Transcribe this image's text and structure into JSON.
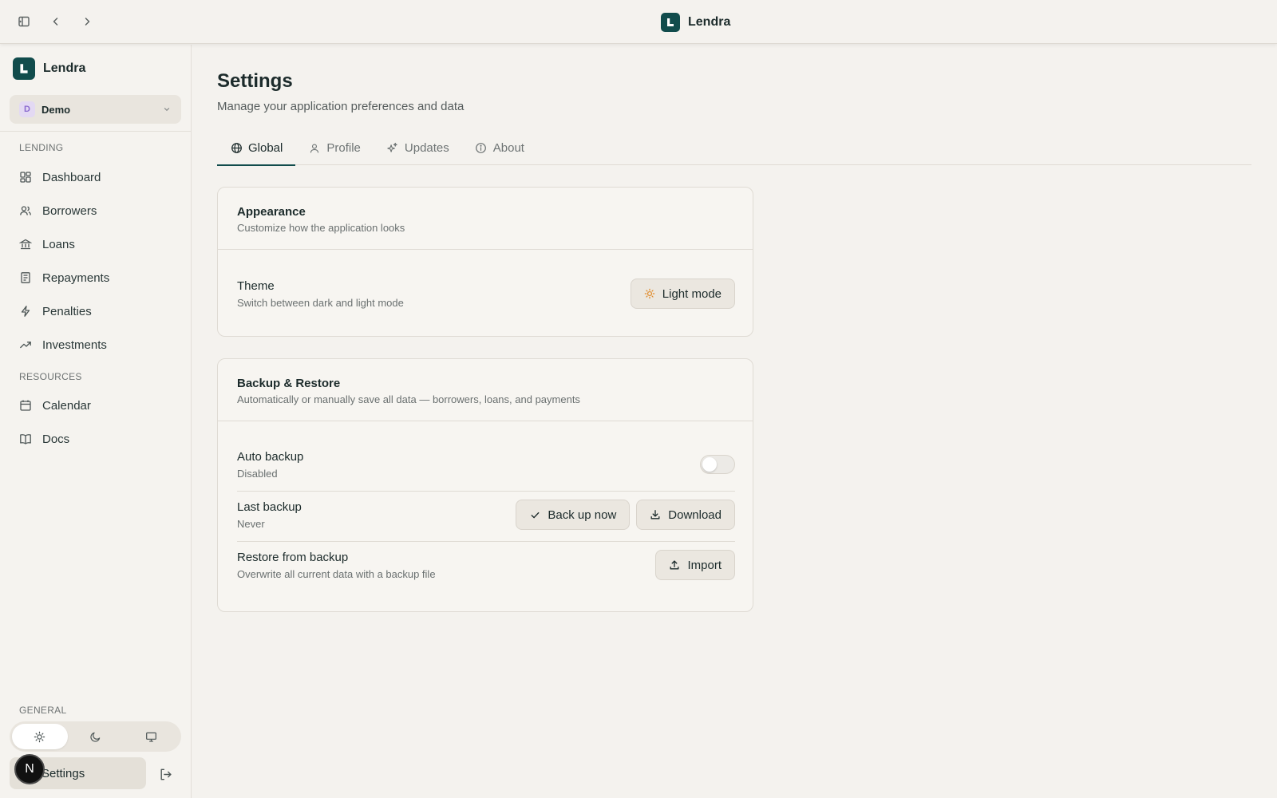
{
  "app": {
    "name": "Lendra"
  },
  "topbar": {
    "sidebar_toggle_icon": "sidebar-toggle-icon",
    "back_icon": "chevron-left-icon",
    "forward_icon": "chevron-right-icon",
    "brand": "Lendra"
  },
  "sidebar": {
    "brand": "Lendra",
    "workspace": {
      "initial": "D",
      "name": "Demo"
    },
    "sections": {
      "lending": "LENDING",
      "resources": "RESOURCES",
      "general": "GENERAL"
    },
    "lending_items": [
      {
        "label": "Dashboard",
        "icon": "dashboard-icon"
      },
      {
        "label": "Borrowers",
        "icon": "users-icon"
      },
      {
        "label": "Loans",
        "icon": "bank-icon"
      },
      {
        "label": "Repayments",
        "icon": "receipt-icon"
      },
      {
        "label": "Penalties",
        "icon": "lightning-icon"
      },
      {
        "label": "Investments",
        "icon": "trending-up-icon"
      }
    ],
    "resource_items": [
      {
        "label": "Calendar",
        "icon": "calendar-icon"
      },
      {
        "label": "Docs",
        "icon": "book-icon"
      }
    ],
    "theme_options": [
      "light",
      "dark",
      "system"
    ],
    "theme_selected": "light",
    "settings_label": "Settings",
    "user_initial": "N"
  },
  "main": {
    "title": "Settings",
    "subtitle": "Manage your application preferences and data",
    "tabs": [
      {
        "label": "Global",
        "icon": "globe-icon",
        "active": true
      },
      {
        "label": "Profile",
        "icon": "user-icon",
        "active": false
      },
      {
        "label": "Updates",
        "icon": "sparkles-icon",
        "active": false
      },
      {
        "label": "About",
        "icon": "info-icon",
        "active": false
      }
    ],
    "appearance": {
      "title": "Appearance",
      "description": "Customize how the application looks",
      "theme": {
        "title": "Theme",
        "description": "Switch between dark and light mode",
        "button_label": "Light mode"
      }
    },
    "backup": {
      "title": "Backup & Restore",
      "description": "Automatically or manually save all data — borrowers, loans, and payments",
      "auto_backup": {
        "title": "Auto backup",
        "status": "Disabled",
        "enabled": false
      },
      "last_backup": {
        "title": "Last backup",
        "value": "Never",
        "backup_now_label": "Back up now",
        "download_label": "Download"
      },
      "restore": {
        "title": "Restore from backup",
        "description": "Overwrite all current data with a backup file",
        "import_label": "Import"
      }
    }
  },
  "colors": {
    "brand": "#114c4c",
    "background": "#f4f2ee",
    "accent_sun": "#e08a2a"
  }
}
